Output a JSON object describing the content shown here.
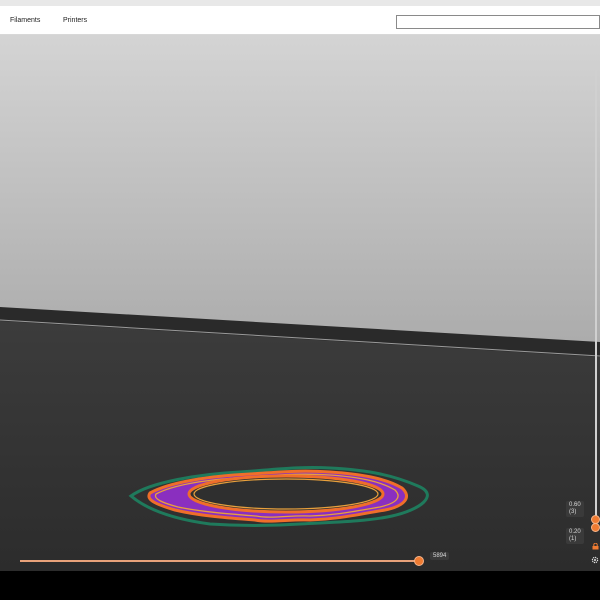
{
  "tabs": {
    "filaments": "Filaments",
    "printers": "Printers"
  },
  "search": {
    "value": "",
    "placeholder": ""
  },
  "layer_slider": {
    "top_label_line1": "0.60",
    "top_label_line2": "(3)",
    "bottom_label_line1": "0.20",
    "bottom_label_line2": "(1)"
  },
  "move_slider": {
    "label": "5894"
  },
  "icons": {
    "slider_settings": "cog-icon",
    "slider_lock": "lock-icon"
  },
  "colors": {
    "accent": "#ef7b32",
    "skirt": "#1f7a5c",
    "perimeter": "#e8a03c",
    "infill": "#8a2fbf",
    "outer_wall": "#ef6e2a"
  }
}
